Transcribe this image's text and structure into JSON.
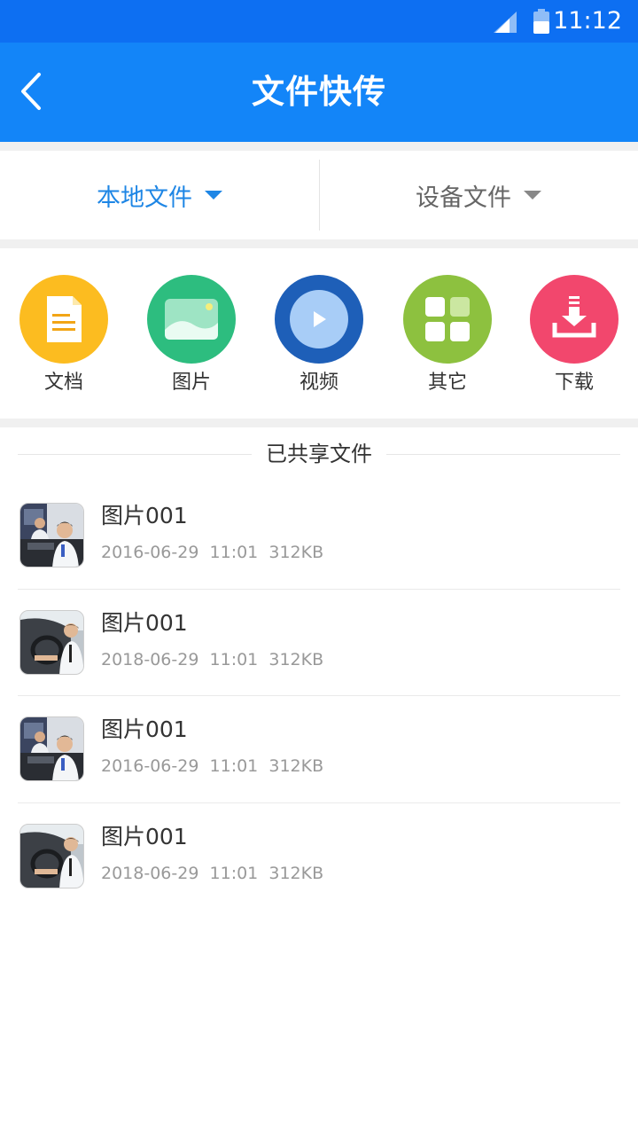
{
  "status": {
    "time": "11:12"
  },
  "header": {
    "title": "文件快传"
  },
  "tabs": [
    {
      "label": "本地文件",
      "active": true
    },
    {
      "label": "设备文件",
      "active": false
    }
  ],
  "categories": [
    {
      "label": "文档",
      "icon": "document-icon",
      "color": "#fcbc20"
    },
    {
      "label": "图片",
      "icon": "image-icon",
      "color": "#2dbd7f"
    },
    {
      "label": "视频",
      "icon": "video-icon",
      "color": "#1e5fb8"
    },
    {
      "label": "其它",
      "icon": "grid-icon",
      "color": "#8dc13f"
    },
    {
      "label": "下载",
      "icon": "download-icon",
      "color": "#f2476d"
    }
  ],
  "shared": {
    "title": "已共享文件",
    "files": [
      {
        "name": "图片001",
        "date": "2016-06-29",
        "time": "11:01",
        "size": "312KB",
        "thumb": "office-photo"
      },
      {
        "name": "图片001",
        "date": "2018-06-29",
        "time": "11:01",
        "size": "312KB",
        "thumb": "car-photo"
      },
      {
        "name": "图片001",
        "date": "2016-06-29",
        "time": "11:01",
        "size": "312KB",
        "thumb": "office-photo"
      },
      {
        "name": "图片001",
        "date": "2018-06-29",
        "time": "11:01",
        "size": "312KB",
        "thumb": "car-photo"
      }
    ]
  },
  "colors": {
    "statusbar": "#0d6ff2",
    "navbar": "#1385f8",
    "active_tab": "#1e86e5"
  }
}
